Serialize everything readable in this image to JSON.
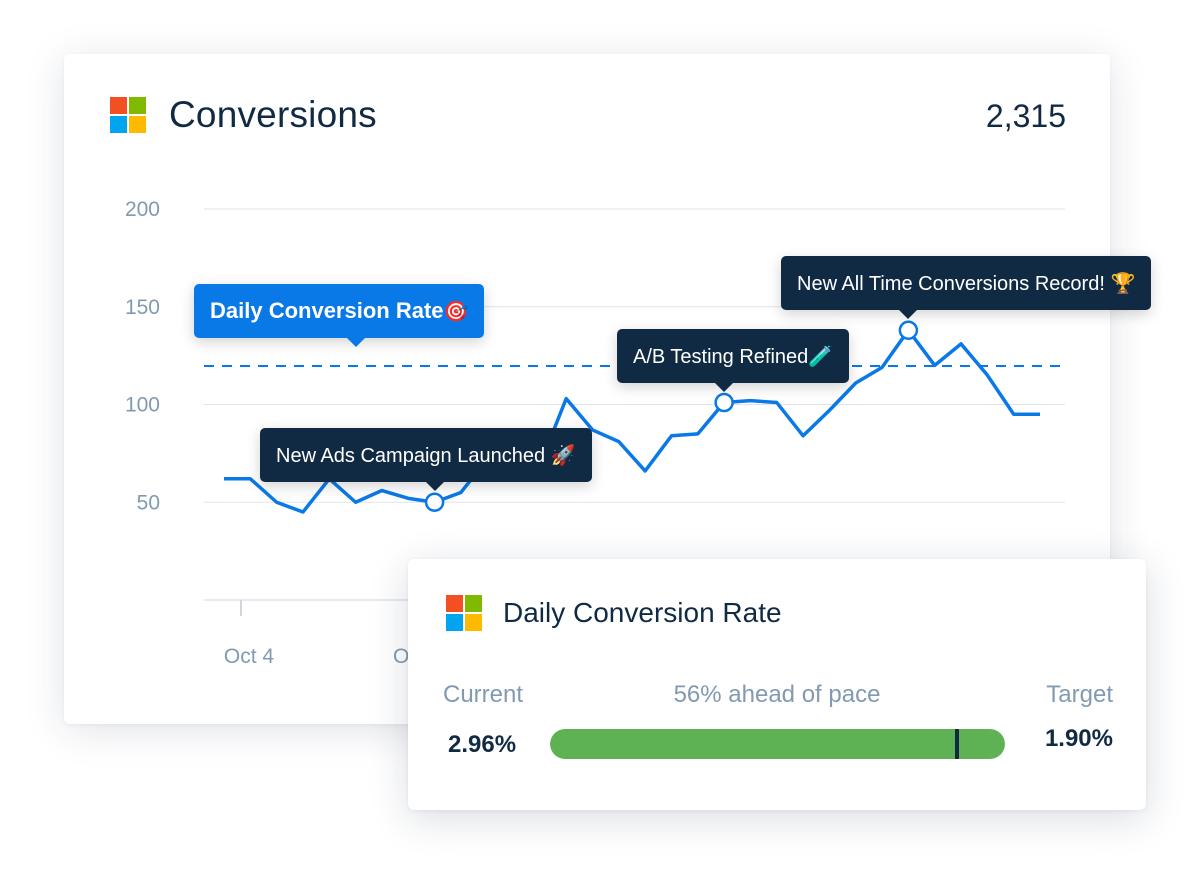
{
  "main_card": {
    "title": "Conversions",
    "total": "2,315",
    "logo": "microsoft-logo"
  },
  "chart_data": {
    "type": "line",
    "title": "Conversions",
    "xlabel": "",
    "ylabel": "",
    "ylim": [
      0,
      200
    ],
    "y_ticks": [
      "200",
      "150",
      "100",
      "50"
    ],
    "y_tick_values": [
      200,
      150,
      100,
      50
    ],
    "x_tick_labels": [
      "Oct 4",
      "O"
    ],
    "grid": true,
    "series": [
      {
        "name": "Conversions",
        "color": "#0a79e8",
        "x": [
          0,
          1,
          2,
          3,
          4,
          5,
          6,
          7,
          8,
          9,
          10,
          11,
          12,
          13,
          14,
          15,
          16,
          17,
          18,
          19,
          20,
          21,
          22,
          23,
          24,
          25,
          26,
          27,
          28,
          29,
          30,
          31
        ],
        "values": [
          62,
          62,
          50,
          45,
          62,
          50,
          56,
          52,
          50,
          55,
          72,
          67,
          69,
          103,
          87,
          81,
          66,
          84,
          85,
          101,
          102,
          101,
          84,
          97,
          111,
          119,
          138,
          120,
          131,
          115,
          95,
          95
        ]
      }
    ],
    "target_line": {
      "label": "Daily Conversion Rate",
      "value": 120,
      "style": "dashed",
      "color": "#0a79e8"
    },
    "annotations": [
      {
        "index": 8,
        "text": "New Ads Campaign Launched",
        "emoji": "🚀"
      },
      {
        "index": 19,
        "text": "A/B Testing Refined",
        "emoji": "🧪"
      },
      {
        "index": 26,
        "text": "New All Time Conversions Record!",
        "emoji": "🏆"
      }
    ]
  },
  "callouts": {
    "target": {
      "text": "Daily Conversion Rate",
      "emoji": "🎯"
    },
    "ads": {
      "text": "New Ads Campaign Launched",
      "emoji": "🚀"
    },
    "ab": {
      "text": "A/B Testing Refined",
      "emoji": "🧪"
    },
    "record": {
      "text": "New All Time Conversions Record!",
      "emoji": "🏆"
    }
  },
  "goal_card": {
    "title": "Daily Conversion Rate",
    "logo": "microsoft-logo",
    "current_label": "Current",
    "current_value": "2.96%",
    "pace_text": "56% ahead of pace",
    "target_label": "Target",
    "target_value": "1.90%",
    "progress_fraction": 1.0,
    "target_marker_fraction": 0.89,
    "bar_color": "#5fb254"
  }
}
